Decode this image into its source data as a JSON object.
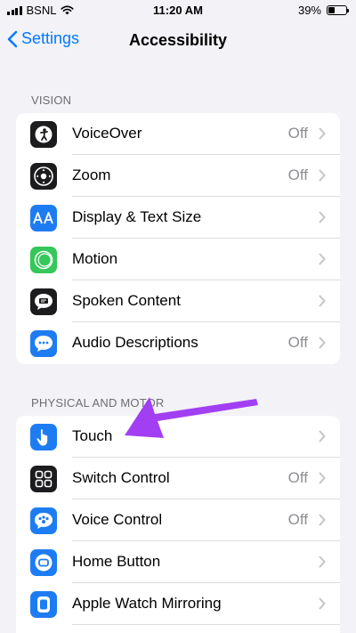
{
  "status_bar": {
    "carrier": "BSNL",
    "time": "11:20 AM",
    "battery": "39%",
    "battery_level": 0.39
  },
  "nav": {
    "back_label": "Settings",
    "title": "Accessibility"
  },
  "sections": [
    {
      "header": "VISION",
      "items": [
        {
          "label": "VoiceOver",
          "value": "Off",
          "icon": "voiceover-icon",
          "color": "#1c1c1e"
        },
        {
          "label": "Zoom",
          "value": "Off",
          "icon": "zoom-icon",
          "color": "#1c1c1e"
        },
        {
          "label": "Display & Text Size",
          "value": "",
          "icon": "display-text-size-icon",
          "color": "#1e7cf2"
        },
        {
          "label": "Motion",
          "value": "",
          "icon": "motion-icon",
          "color": "#34c759"
        },
        {
          "label": "Spoken Content",
          "value": "",
          "icon": "spoken-content-icon",
          "color": "#1c1c1e"
        },
        {
          "label": "Audio Descriptions",
          "value": "Off",
          "icon": "audio-descriptions-icon",
          "color": "#1e7cf2"
        }
      ]
    },
    {
      "header": "PHYSICAL AND MOTOR",
      "items": [
        {
          "label": "Touch",
          "value": "",
          "icon": "touch-icon",
          "color": "#1e7cf2"
        },
        {
          "label": "Switch Control",
          "value": "Off",
          "icon": "switch-control-icon",
          "color": "#1c1c1e"
        },
        {
          "label": "Voice Control",
          "value": "Off",
          "icon": "voice-control-icon",
          "color": "#1e7cf2"
        },
        {
          "label": "Home Button",
          "value": "",
          "icon": "home-button-icon",
          "color": "#1e7cf2"
        },
        {
          "label": "Apple Watch Mirroring",
          "value": "",
          "icon": "apple-watch-mirroring-icon",
          "color": "#1e7cf2"
        }
      ]
    }
  ],
  "annotation": {
    "color": "#a23ff2"
  }
}
